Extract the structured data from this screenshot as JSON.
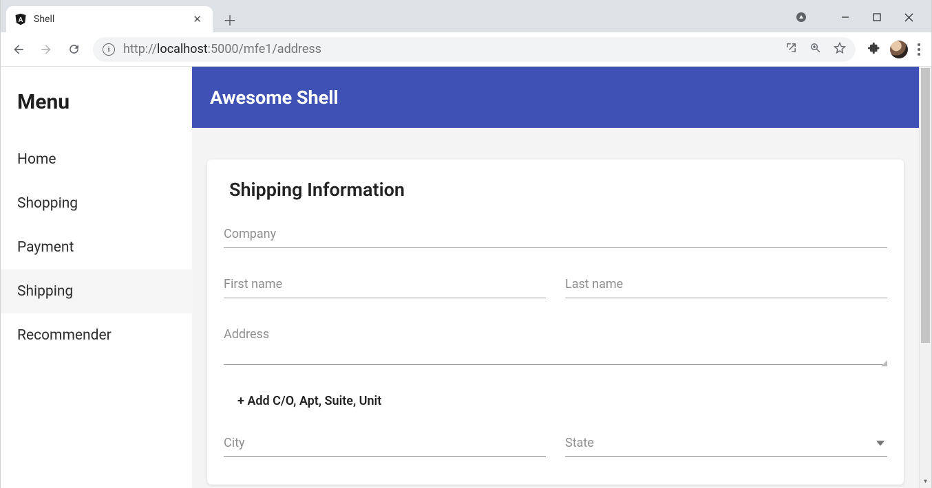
{
  "browser": {
    "tab_title": "Shell",
    "url_full": "http://localhost:5000/mfe1/address",
    "url_prefix": "http://",
    "url_host": "localhost",
    "url_path": ":5000/mfe1/address"
  },
  "sidebar": {
    "title": "Menu",
    "items": [
      {
        "label": "Home",
        "active": false
      },
      {
        "label": "Shopping",
        "active": false
      },
      {
        "label": "Payment",
        "active": false
      },
      {
        "label": "Shipping",
        "active": true
      },
      {
        "label": "Recommender",
        "active": false
      }
    ]
  },
  "header": {
    "title": "Awesome Shell"
  },
  "form": {
    "title": "Shipping Information",
    "company_label": "Company",
    "first_name_label": "First name",
    "last_name_label": "Last name",
    "address_label": "Address",
    "add_line_label": "+ Add C/O, Apt, Suite, Unit",
    "city_label": "City",
    "state_label": "State"
  }
}
